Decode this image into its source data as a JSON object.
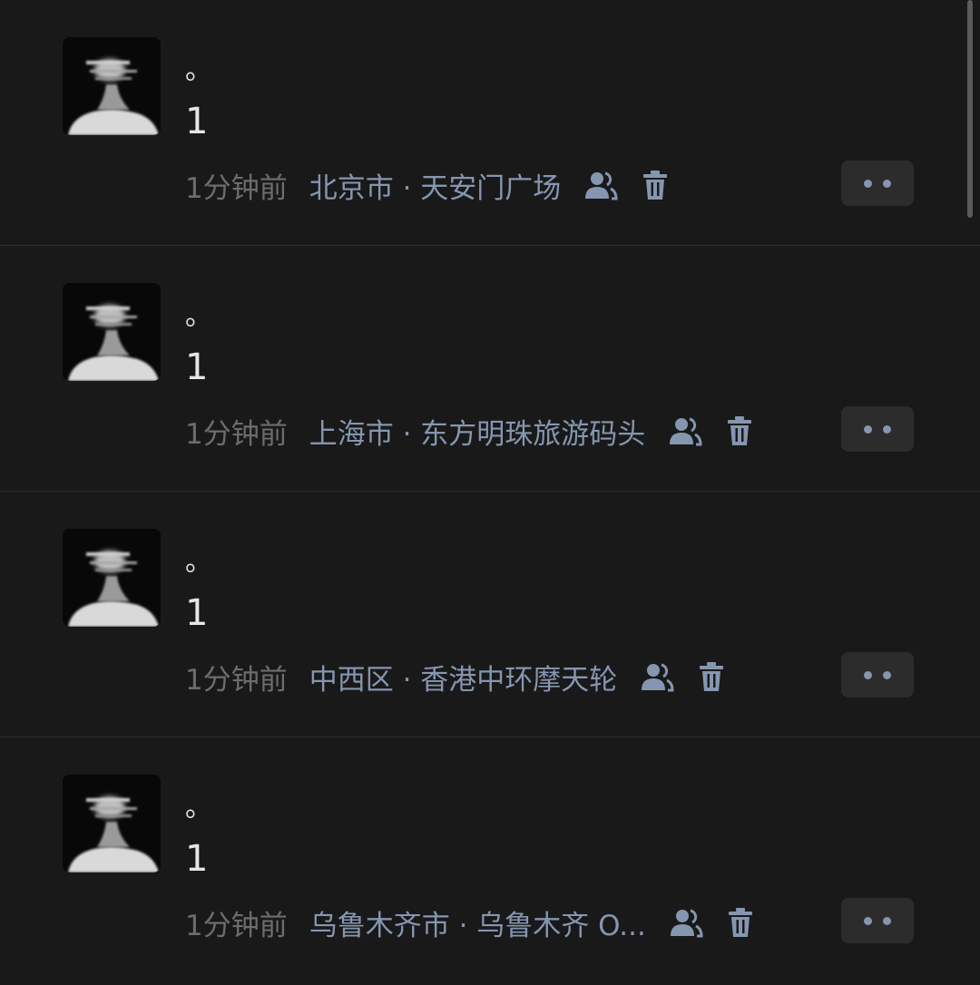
{
  "feed": {
    "posts": [
      {
        "line1": "。",
        "line2": "1",
        "time": "1分钟前",
        "location": "北京市 · 天安门广场"
      },
      {
        "line1": "。",
        "line2": "1",
        "time": "1分钟前",
        "location": "上海市 · 东方明珠旅游码头"
      },
      {
        "line1": "。",
        "line2": "1",
        "time": "1分钟前",
        "location": "中西区 · 香港中环摩天轮"
      },
      {
        "line1": "。",
        "line2": "1",
        "time": "1分钟前",
        "location": "乌鲁木齐市 · 乌鲁木齐 O..."
      }
    ]
  },
  "icons": {
    "visibility": "friends-icon",
    "delete": "trash-icon",
    "more": "more-dots-icon"
  },
  "colors": {
    "background": "#191919",
    "accent": "#8596b0",
    "time_text": "#6d6d6d",
    "more_button_bg": "#2c2c2c"
  }
}
